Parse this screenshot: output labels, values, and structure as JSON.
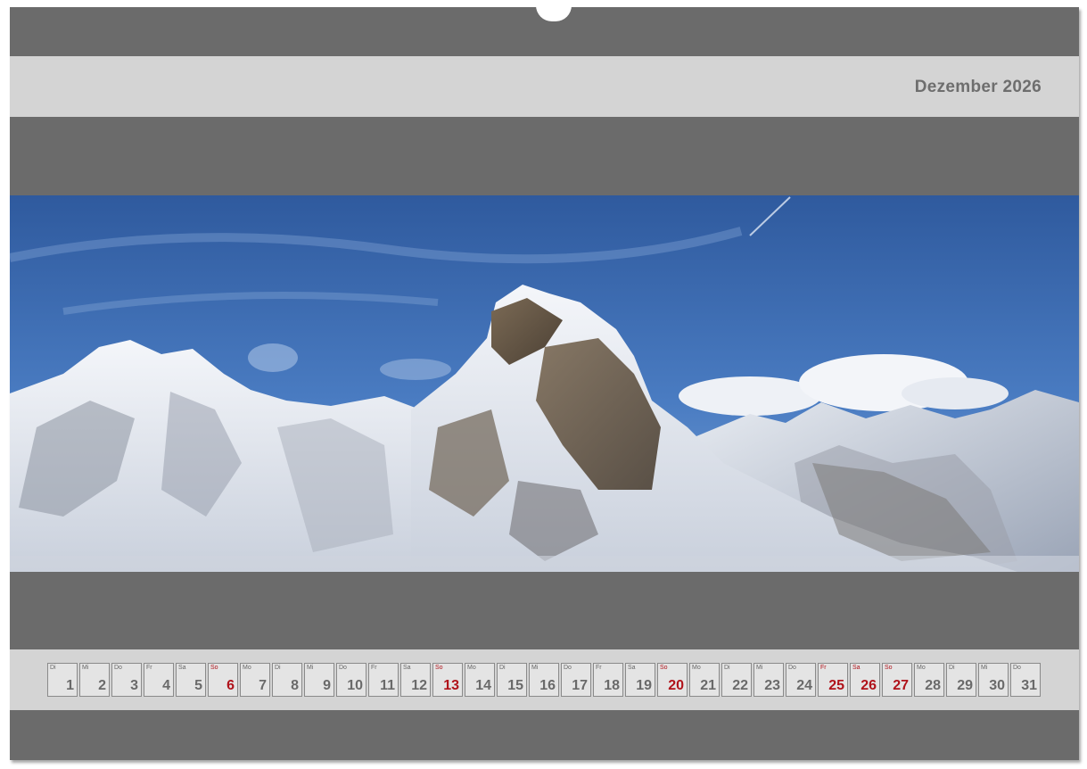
{
  "calendar": {
    "month_title": "Dezember 2026",
    "colors": {
      "frame": "#6b6b6b",
      "band": "#d4d4d4",
      "day_text": "#6a6a6a",
      "holiday_text": "#b0121a"
    },
    "days": [
      {
        "wd": "Di",
        "num": "1",
        "red": false
      },
      {
        "wd": "Mi",
        "num": "2",
        "red": false
      },
      {
        "wd": "Do",
        "num": "3",
        "red": false
      },
      {
        "wd": "Fr",
        "num": "4",
        "red": false
      },
      {
        "wd": "Sa",
        "num": "5",
        "red": false
      },
      {
        "wd": "So",
        "num": "6",
        "red": true
      },
      {
        "wd": "Mo",
        "num": "7",
        "red": false
      },
      {
        "wd": "Di",
        "num": "8",
        "red": false
      },
      {
        "wd": "Mi",
        "num": "9",
        "red": false
      },
      {
        "wd": "Do",
        "num": "10",
        "red": false
      },
      {
        "wd": "Fr",
        "num": "11",
        "red": false
      },
      {
        "wd": "Sa",
        "num": "12",
        "red": false
      },
      {
        "wd": "So",
        "num": "13",
        "red": true
      },
      {
        "wd": "Mo",
        "num": "14",
        "red": false
      },
      {
        "wd": "Di",
        "num": "15",
        "red": false
      },
      {
        "wd": "Mi",
        "num": "16",
        "red": false
      },
      {
        "wd": "Do",
        "num": "17",
        "red": false
      },
      {
        "wd": "Fr",
        "num": "18",
        "red": false
      },
      {
        "wd": "Sa",
        "num": "19",
        "red": false
      },
      {
        "wd": "So",
        "num": "20",
        "red": true
      },
      {
        "wd": "Mo",
        "num": "21",
        "red": false
      },
      {
        "wd": "Di",
        "num": "22",
        "red": false
      },
      {
        "wd": "Mi",
        "num": "23",
        "red": false
      },
      {
        "wd": "Do",
        "num": "24",
        "red": false
      },
      {
        "wd": "Fr",
        "num": "25",
        "red": true
      },
      {
        "wd": "Sa",
        "num": "26",
        "red": true
      },
      {
        "wd": "So",
        "num": "27",
        "red": true
      },
      {
        "wd": "Mo",
        "num": "28",
        "red": false
      },
      {
        "wd": "Di",
        "num": "29",
        "red": false
      },
      {
        "wd": "Mi",
        "num": "30",
        "red": false
      },
      {
        "wd": "Do",
        "num": "31",
        "red": false
      }
    ]
  }
}
